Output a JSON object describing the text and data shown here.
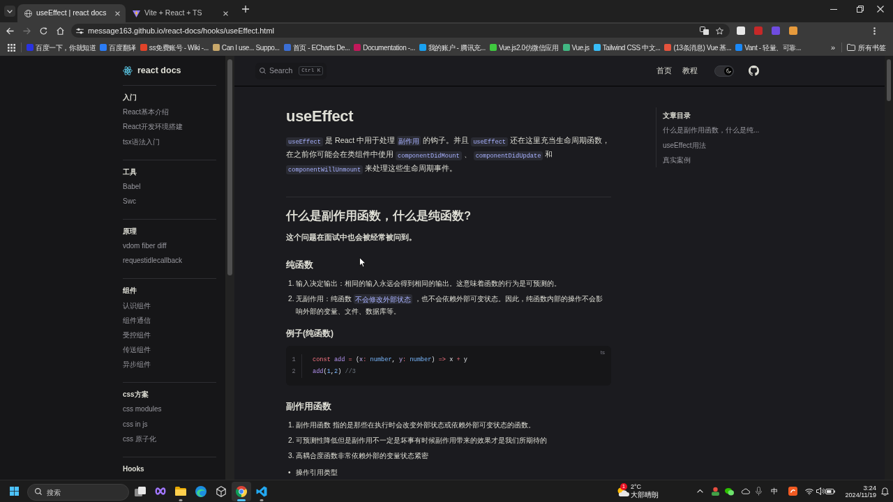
{
  "browser": {
    "tabs": [
      {
        "kind": "globe",
        "title": "useEffect | react docs",
        "selected": true
      },
      {
        "kind": "vite",
        "title": "Vite + React + TS",
        "selected": false
      }
    ],
    "nav_buttons": [
      {
        "kind": "back",
        "disabled": false
      },
      {
        "kind": "forward",
        "disabled": true
      },
      {
        "kind": "reload",
        "disabled": false
      },
      {
        "kind": "home",
        "disabled": false
      }
    ],
    "address": "message163.github.io/react-docs/hooks/useEffect.html",
    "bookmarks": [
      {
        "label": "百度一下，你就知道",
        "color": "#2932e1"
      },
      {
        "label": "百度翻译",
        "color": "#2b7cf6"
      },
      {
        "label": "ss免费账号 - Wiki -...",
        "color": "#e24329"
      },
      {
        "label": "Can I use... Suppo...",
        "color": "#c9a86a"
      },
      {
        "label": "首页 - ECharts De...",
        "color": "#3b6fd6"
      },
      {
        "label": "Documentation -...",
        "color": "#c2185b"
      },
      {
        "label": "我的账户 - 腾讯充...",
        "color": "#19a0f0"
      },
      {
        "label": "Vue.js2.0仿微信应用",
        "color": "#3fc93f"
      },
      {
        "label": "Vue.js",
        "color": "#41b883"
      },
      {
        "label": "Tailwind CSS 中文...",
        "color": "#38bdf8"
      },
      {
        "label": "(13条消息) Vue 基...",
        "color": "#e5533d"
      },
      {
        "label": "Vant - 轻量、可靠...",
        "color": "#1989fa"
      }
    ],
    "bookmarks_overflow": "»",
    "all_bookmarks": "所有书签"
  },
  "sidebar": {
    "logo_text": "react docs",
    "groups": [
      {
        "title": "入门",
        "items": [
          "React基本介绍",
          "React开发环境搭建",
          "tsx语法入门"
        ]
      },
      {
        "title": "工具",
        "items": [
          "Babel",
          "Swc"
        ]
      },
      {
        "title": "原理",
        "items": [
          "vdom fiber diff",
          "requestidlecallback"
        ]
      },
      {
        "title": "组件",
        "items": [
          "认识组件",
          "组件通信",
          "受控组件",
          "传送组件",
          "异步组件"
        ]
      },
      {
        "title": "css方案",
        "items": [
          "css modules",
          "css in js",
          "css 原子化"
        ]
      },
      {
        "title": "Hooks"
      }
    ]
  },
  "header": {
    "search": {
      "label": "Search",
      "shortcut": "Ctrl K"
    },
    "nav_links": [
      "首页",
      "教程"
    ],
    "theme_toggle": {
      "on": true
    }
  },
  "article": {
    "blocks": [
      {
        "kind": "h1",
        "text": "useEffect"
      },
      {
        "kind": "paragraph",
        "segments": [
          {
            "kind": "code",
            "text": "useEffect"
          },
          {
            "kind": "text",
            "text": " 是 React 中用于处理 "
          },
          {
            "kind": "highlight",
            "text": "副作用"
          },
          {
            "kind": "text",
            "text": " 的钩子。并且 "
          },
          {
            "kind": "code",
            "text": "useEffect"
          },
          {
            "kind": "text",
            "text": " 还在这里充当生命周期函数，在之前你可能会在类组件中使用 "
          },
          {
            "kind": "code",
            "text": "componentDidMount"
          },
          {
            "kind": "text",
            "text": " 、 "
          },
          {
            "kind": "code",
            "text": "componentDidUpdate"
          },
          {
            "kind": "text",
            "text": " 和 "
          },
          {
            "kind": "code",
            "text": "componentWillUnmount"
          },
          {
            "kind": "text",
            "text": " 来处理这些生命周期事件。"
          }
        ]
      },
      {
        "kind": "h2",
        "text": "什么是副作用函数，什么是纯函数?"
      },
      {
        "kind": "strong",
        "text": "这个问题在面试中也会被经常被问到。"
      },
      {
        "kind": "h3",
        "text": "纯函数"
      },
      {
        "kind": "ordered_list",
        "items": [
          {
            "number": "1.",
            "segments": [
              {
                "kind": "text",
                "text": "输入决定输出：相同的输入永远会得到相同的输出。这意味着函数的行为是可预测的。"
              }
            ]
          },
          {
            "number": "2.",
            "segments": [
              {
                "kind": "text",
                "text": "无副作用：纯函数 "
              },
              {
                "kind": "highlight",
                "text": "不会修改外部状态"
              },
              {
                "kind": "text",
                "text": " ，也不会依赖外部可变状态。因此，纯函数内部的操作不会影响外部的变量、文件、数据库等。"
              }
            ]
          }
        ]
      },
      {
        "kind": "h4",
        "text": "例子(纯函数)"
      },
      {
        "kind": "code",
        "lang": "ts",
        "lines": [
          {
            "number": "1",
            "tokens": [
              {
                "kind": "keyword",
                "text": "const "
              },
              {
                "kind": "function",
                "text": "add "
              },
              {
                "kind": "operator",
                "text": "="
              },
              {
                "kind": "plain",
                "text": " ("
              },
              {
                "kind": "param",
                "text": "x"
              },
              {
                "kind": "operator",
                "text": ":"
              },
              {
                "kind": "type",
                "text": " number"
              },
              {
                "kind": "plain",
                "text": ", "
              },
              {
                "kind": "param",
                "text": "y"
              },
              {
                "kind": "operator",
                "text": ":"
              },
              {
                "kind": "type",
                "text": " number"
              },
              {
                "kind": "plain",
                "text": ") "
              },
              {
                "kind": "operator",
                "text": "=>"
              },
              {
                "kind": "plain",
                "text": " x "
              },
              {
                "kind": "operator",
                "text": "+"
              },
              {
                "kind": "plain",
                "text": " y"
              }
            ]
          },
          {
            "number": "2",
            "tokens": [
              {
                "kind": "function",
                "text": "add"
              },
              {
                "kind": "plain",
                "text": "("
              },
              {
                "kind": "number",
                "text": "1"
              },
              {
                "kind": "plain",
                "text": ","
              },
              {
                "kind": "number",
                "text": "2"
              },
              {
                "kind": "plain",
                "text": ") "
              },
              {
                "kind": "comment",
                "text": "//3"
              }
            ]
          }
        ]
      },
      {
        "kind": "h3",
        "text": "副作用函数"
      },
      {
        "kind": "ordered_list",
        "items": [
          {
            "number": "1.",
            "segments": [
              {
                "kind": "text",
                "text": "副作用函数 指的是那些在执行时会改变外部状态或依赖外部可变状态的函数。"
              }
            ]
          },
          {
            "number": "2.",
            "segments": [
              {
                "kind": "text",
                "text": "可预测性降低但是副作用不一定是坏事有时候副作用带来的效果才是我们所期待的"
              }
            ]
          },
          {
            "number": "3.",
            "segments": [
              {
                "kind": "text",
                "text": "高耦合度函数非常依赖外部的变量状态紧密"
              }
            ]
          }
        ]
      },
      {
        "kind": "bullet_list",
        "items": [
          {
            "marker": "•",
            "segments": [
              {
                "kind": "text",
                "text": "操作引用类型"
              }
            ]
          }
        ]
      }
    ]
  },
  "outline": {
    "title": "文章目录",
    "items": [
      "什么是副作用函数，什么是纯...",
      "useEffect用法",
      "真实案例"
    ]
  },
  "taskbar": {
    "search": {
      "placeholder": "搜索"
    },
    "apps": [
      {
        "kind": "task-view",
        "running": false,
        "selected": false
      },
      {
        "kind": "infinity",
        "running": false,
        "selected": false
      },
      {
        "kind": "folder",
        "running": true,
        "selected": false
      },
      {
        "kind": "wave",
        "running": false,
        "selected": false
      },
      {
        "kind": "cube",
        "running": false,
        "selected": false
      },
      {
        "kind": "tricolor",
        "running": true,
        "selected": true
      },
      {
        "kind": "editor",
        "running": true,
        "selected": false
      }
    ],
    "weather": {
      "badge": "1",
      "temperature": "2°C",
      "condition": "大部晴朗"
    },
    "tray": {
      "ime": "中",
      "time": "3:24",
      "date": "2024/11/19"
    }
  }
}
